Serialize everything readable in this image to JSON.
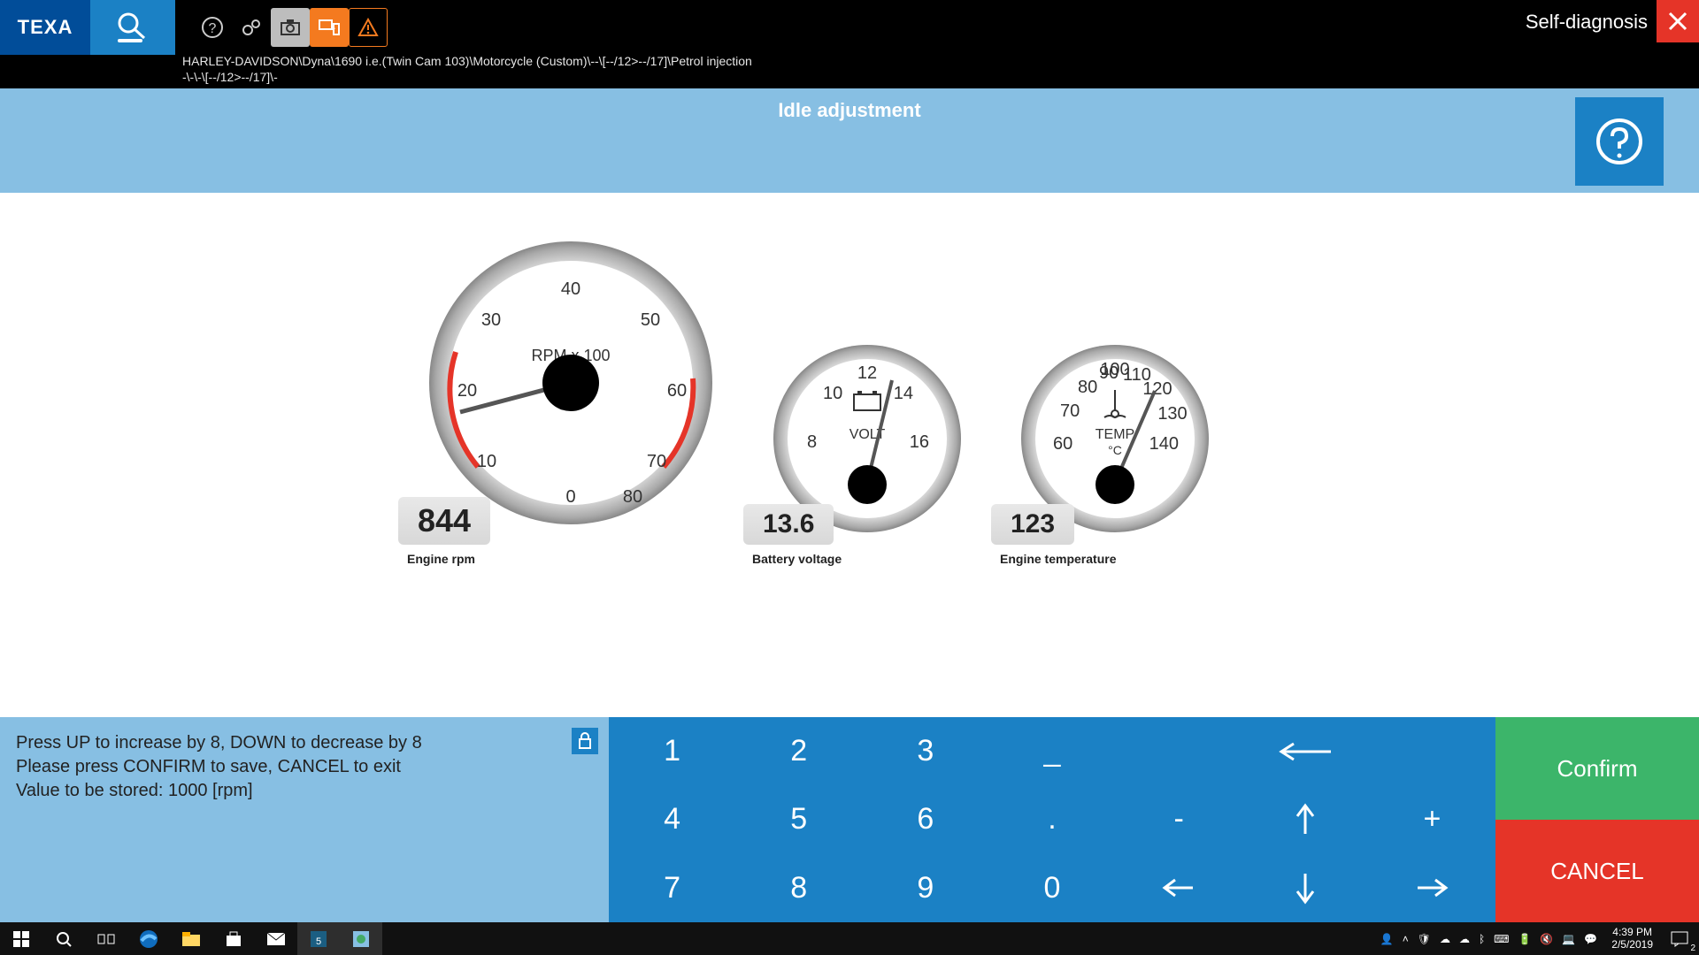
{
  "header": {
    "brand": "TEXA",
    "mode": "Self-diagnosis",
    "breadcrumb_l1": "HARLEY-DAVIDSON\\Dyna\\1690 i.e.(Twin Cam 103)\\Motorcycle (Custom)\\--\\[--/12>--/17]\\Petrol injection",
    "breadcrumb_l2": "-\\-\\-\\[--/12>--/17]\\-"
  },
  "banner": {
    "title": "Idle adjustment"
  },
  "gauges": {
    "rpm": {
      "value": "844",
      "label": "Engine rpm",
      "unit": "RPM x 100"
    },
    "volt": {
      "value": "13.6",
      "label": "Battery voltage",
      "unit": "VOLT"
    },
    "temp": {
      "value": "123",
      "label": "Engine temperature",
      "unit": "TEMP",
      "unit2": "°C"
    }
  },
  "instructions": {
    "l1": "Press UP to increase by 8, DOWN to decrease by 8",
    "l2": "Please press CONFIRM to save, CANCEL to exit",
    "l3": "Value to be stored: 1000 [rpm]"
  },
  "keypad": {
    "k1": "1",
    "k2": "2",
    "k3": "3",
    "k4": "4",
    "k5": "5",
    "k6": "6",
    "k7": "7",
    "k8": "8",
    "k9": "9",
    "k0": "0",
    "underscore": "_",
    "dot": ".",
    "minus": "-",
    "plus": "+"
  },
  "actions": {
    "confirm": "Confirm",
    "cancel": "CANCEL"
  },
  "taskbar": {
    "time": "4:39 PM",
    "date": "2/5/2019",
    "notif_count": "2"
  },
  "chart_data": [
    {
      "type": "gauge",
      "name": "Engine rpm",
      "unit": "RPM x 100",
      "range": [
        0,
        80
      ],
      "ticks": [
        0,
        10,
        20,
        30,
        40,
        50,
        60,
        70,
        80
      ],
      "value": 8.44,
      "display": 844
    },
    {
      "type": "gauge",
      "name": "Battery voltage",
      "unit": "VOLT",
      "range": [
        8,
        16
      ],
      "ticks": [
        8,
        10,
        12,
        14,
        16
      ],
      "value": 13.6,
      "display": 13.6
    },
    {
      "type": "gauge",
      "name": "Engine temperature",
      "unit": "°C",
      "range": [
        60,
        140
      ],
      "ticks": [
        60,
        70,
        80,
        90,
        100,
        110,
        120,
        130,
        140
      ],
      "value": 123,
      "display": 123
    }
  ]
}
